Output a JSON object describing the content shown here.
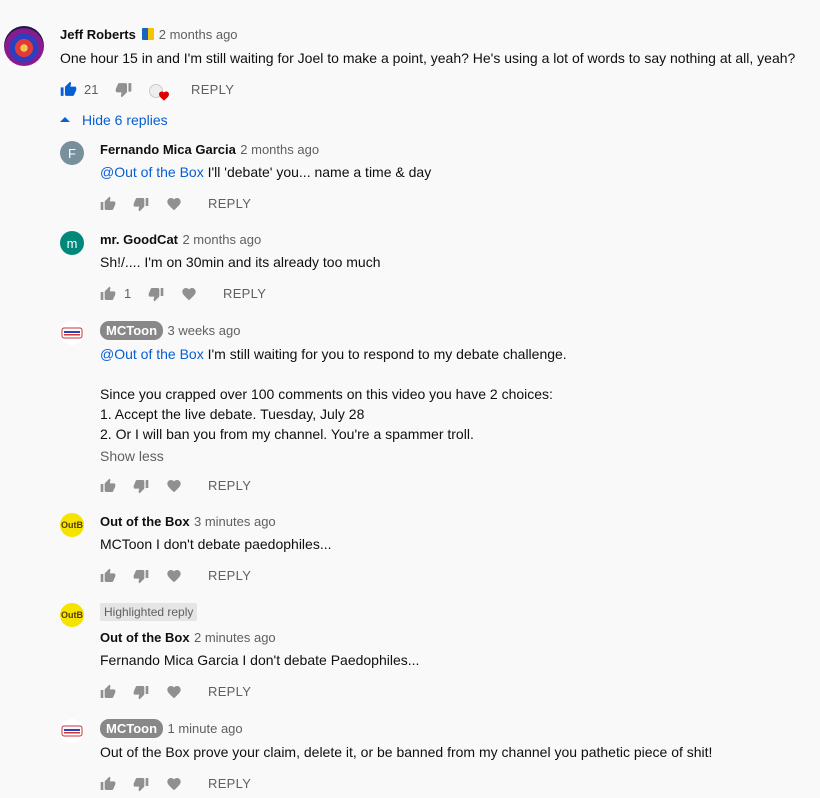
{
  "top_comment": {
    "author": "Jeff Roberts",
    "time": "2 months ago",
    "text": "One hour 15 in and I'm still waiting for Joel to make a point, yeah? He's using a lot of words to say nothing at all, yeah?",
    "likes": "21",
    "reply_label": "REPLY",
    "hide_replies": "Hide 6 replies"
  },
  "replies": [
    {
      "author": "Fernando Mica Garcia",
      "avatar_letter": "F",
      "time": "2 months ago",
      "mention": "@Out of the Box",
      "text": " I'll 'debate' you... name a time & day",
      "reply_label": "REPLY"
    },
    {
      "author": "mr. GoodCat",
      "avatar_letter": "m",
      "time": "2 months ago",
      "text": "Sh!/.... I'm on 30min and its already too much",
      "likes": "1",
      "reply_label": "REPLY"
    },
    {
      "author": "MCToon",
      "time": "3 weeks ago",
      "mention": "@Out of the Box",
      "text_line1": " I'm still waiting for you to respond to my debate challenge.",
      "text_line2": "Since you crapped over 100 comments on this video you have 2 choices:",
      "text_line3": "1. Accept the live debate.  Tuesday, July 28",
      "text_line4": "2. Or I will ban you from my channel.  You're a spammer troll.",
      "show_less": "Show less",
      "reply_label": "REPLY"
    },
    {
      "author": "Out of the Box",
      "avatar_text": "OutB",
      "time": "3 minutes ago",
      "text": "MCToon I don't debate paedophiles...",
      "reply_label": "REPLY"
    },
    {
      "highlighted_label": "Highlighted reply",
      "author": "Out of the Box",
      "avatar_text": "OutB",
      "time": "2 minutes ago",
      "text": "Fernando Mica Garcia I don't debate Paedophiles...",
      "reply_label": "REPLY"
    },
    {
      "author": "MCToon",
      "time": "1 minute ago",
      "text": "Out of the Box prove your claim, delete it, or be banned from my channel you pathetic piece of shit!",
      "reply_label": "REPLY"
    }
  ],
  "colors": {
    "link": "#065fd4",
    "liked": "#065fd4",
    "icon": "#909090",
    "heart": "#e00000"
  },
  "icons": [
    "thumb-up-icon",
    "thumb-down-icon",
    "heart-icon",
    "caret-up-icon",
    "verified-badge-icon"
  ]
}
